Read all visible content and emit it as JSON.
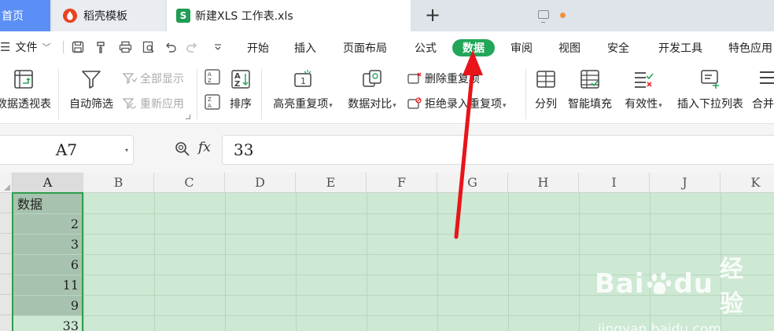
{
  "tabs": {
    "home": "首页",
    "daoke": "稻壳模板",
    "file": "新建XLS 工作表.xls",
    "file_icon_letter": "S",
    "new_tab": "+"
  },
  "menubar": {
    "file_menu": "文件",
    "items": [
      "开始",
      "插入",
      "页面布局",
      "公式",
      "数据",
      "审阅",
      "视图",
      "安全",
      "开发工具",
      "特色应用"
    ],
    "active_item": "数据"
  },
  "ribbon": {
    "pivot": "数据透视表",
    "autofilter": "自动筛选",
    "show_all": "全部显示",
    "reapply": "重新应用",
    "sort": "排序",
    "highlight_dup": "高亮重复项",
    "compare": "数据对比",
    "delete_dup": "删除重复项",
    "reject_dup": "拒绝录入重复项",
    "split_col": "分列",
    "flash_fill": "智能填充",
    "validity": "有效性",
    "insert_dropdown": "插入下拉列表",
    "merge": "合并"
  },
  "formula_bar": {
    "name_box": "A7",
    "fx_label": "fx",
    "value": "33"
  },
  "sheet": {
    "columns": [
      "A",
      "B",
      "C",
      "D",
      "E",
      "F",
      "G",
      "H",
      "I",
      "J",
      "K"
    ],
    "column_a": [
      "数据",
      "2",
      "3",
      "6",
      "11",
      "9",
      "33"
    ]
  },
  "watermark": {
    "main_left": "Bai",
    "main_right": "du",
    "brand_cn": "经验",
    "sub": "jingyan.baidu.com"
  },
  "colors": {
    "accent_green": "#22a75a",
    "home_tab_blue": "#5b8ff5",
    "sheet_bg": "#cde8d3",
    "annotation_red": "#e8141a"
  }
}
